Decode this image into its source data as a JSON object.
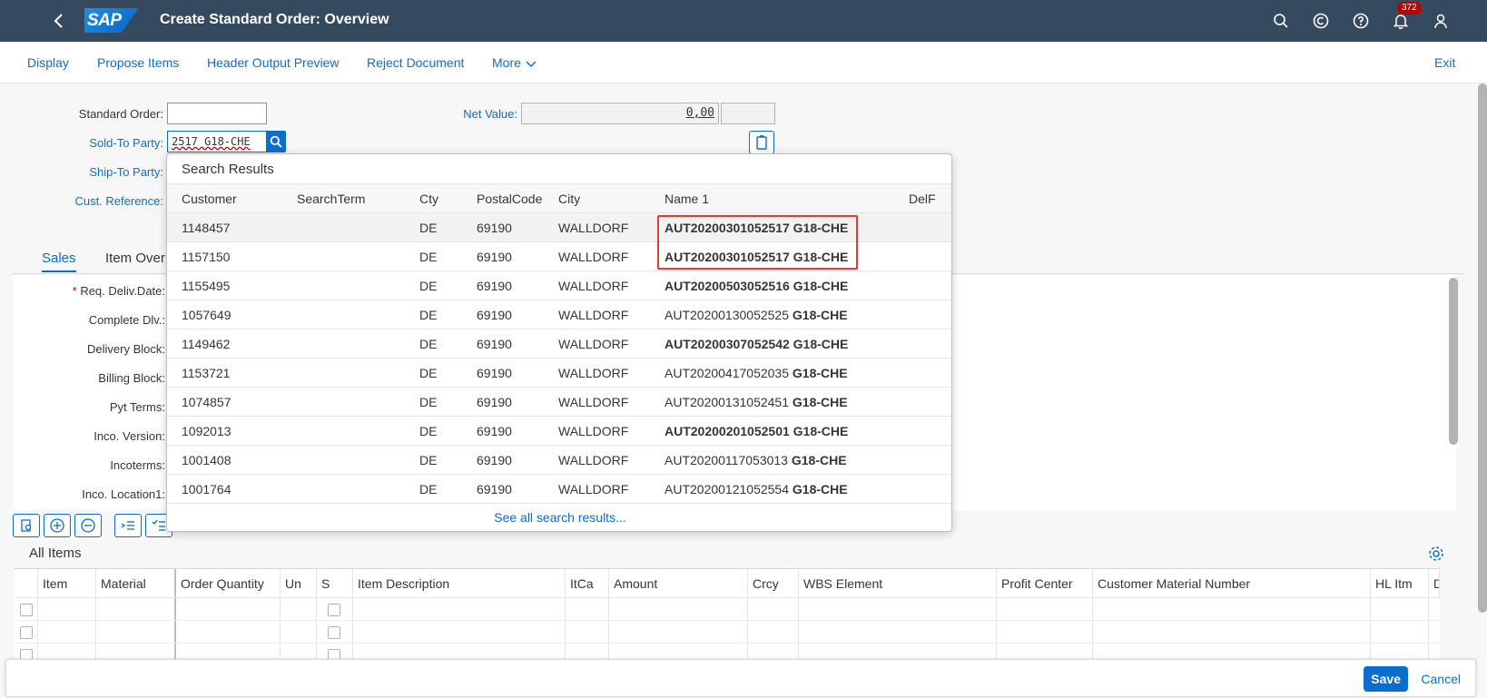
{
  "shell": {
    "title": "Create Standard Order: Overview",
    "logo": "SAP",
    "notification_count": "372",
    "icons": [
      "back-icon",
      "search-icon",
      "copilot-icon",
      "help-icon",
      "bell-icon",
      "user-icon"
    ]
  },
  "toolbar": {
    "display": "Display",
    "propose_items": "Propose Items",
    "header_output_preview": "Header Output Preview",
    "reject_document": "Reject Document",
    "more": "More",
    "exit": "Exit"
  },
  "form": {
    "standard_order_label": "Standard Order:",
    "standard_order_value": "",
    "sold_to_label": "Sold-To Party:",
    "sold_to_value": "2517 G18-CHE",
    "ship_to_label": "Ship-To Party:",
    "cust_ref_label": "Cust. Reference:",
    "net_value_label": "Net Value:",
    "net_value": "0,00",
    "currency": ""
  },
  "tabs": [
    "Sales",
    "Item Over"
  ],
  "sales_fields": {
    "req_deliv_date": "Req. Deliv.Date:",
    "complete_dlv": "Complete Dlv.:",
    "delivery_block": "Delivery Block:",
    "billing_block": "Billing Block:",
    "pyt_terms": "Pyt Terms:",
    "inco_version": "Inco. Version:",
    "incoterms": "Incoterms:",
    "inco_location1": "Inco. Location1:"
  },
  "items": {
    "title": "All Items",
    "columns": [
      "Item",
      "Material",
      "Order Quantity",
      "Un",
      "S",
      "Item Description",
      "ItCa",
      "Amount",
      "Crcy",
      "WBS Element",
      "Profit Center",
      "Customer Material Number",
      "HL Itm",
      "D"
    ]
  },
  "search_results": {
    "title": "Search Results",
    "columns": [
      "Customer",
      "SearchTerm",
      "Cty",
      "PostalCode",
      "City",
      "Name 1",
      "DelF"
    ],
    "rows": [
      {
        "customer": "1148457",
        "cty": "DE",
        "postal": "69190",
        "city": "WALLDORF",
        "name_pre": "AUT20200301052517",
        "name_bold_pre": true,
        "name_suffix": "G18-CHE"
      },
      {
        "customer": "1157150",
        "cty": "DE",
        "postal": "69190",
        "city": "WALLDORF",
        "name_pre": "AUT20200301052517",
        "name_bold_pre": true,
        "name_suffix": "G18-CHE"
      },
      {
        "customer": "1155495",
        "cty": "DE",
        "postal": "69190",
        "city": "WALLDORF",
        "name_pre": "AUT20200503052516",
        "name_bold_pre": true,
        "name_suffix": "G18-CHE"
      },
      {
        "customer": "1057649",
        "cty": "DE",
        "postal": "69190",
        "city": "WALLDORF",
        "name_pre": "AUT20200130052525",
        "name_bold_pre": false,
        "name_suffix": "G18-CHE"
      },
      {
        "customer": "1149462",
        "cty": "DE",
        "postal": "69190",
        "city": "WALLDORF",
        "name_pre": "AUT20200307052542",
        "name_bold_pre": true,
        "name_suffix": "G18-CHE"
      },
      {
        "customer": "1153721",
        "cty": "DE",
        "postal": "69190",
        "city": "WALLDORF",
        "name_pre": "AUT20200417052035",
        "name_bold_pre": false,
        "name_suffix": "G18-CHE"
      },
      {
        "customer": "1074857",
        "cty": "DE",
        "postal": "69190",
        "city": "WALLDORF",
        "name_pre": "AUT20200131052451",
        "name_bold_pre": false,
        "name_suffix": "G18-CHE"
      },
      {
        "customer": "1092013",
        "cty": "DE",
        "postal": "69190",
        "city": "WALLDORF",
        "name_pre": "AUT20200201052501",
        "name_bold_pre": true,
        "name_suffix": "G18-CHE"
      },
      {
        "customer": "1001408",
        "cty": "DE",
        "postal": "69190",
        "city": "WALLDORF",
        "name_pre": "AUT20200117053013",
        "name_bold_pre": false,
        "name_suffix": "G18-CHE"
      },
      {
        "customer": "1001764",
        "cty": "DE",
        "postal": "69190",
        "city": "WALLDORF",
        "name_pre": "AUT20200121052554",
        "name_bold_pre": false,
        "name_suffix": "G18-CHE"
      }
    ],
    "see_all": "See all search results..."
  },
  "footer": {
    "save": "Save",
    "cancel": "Cancel"
  },
  "colors": {
    "shell": "#354a5f",
    "accent": "#0a6ed1",
    "highlight": "#e53935",
    "badge": "#bb0000"
  }
}
